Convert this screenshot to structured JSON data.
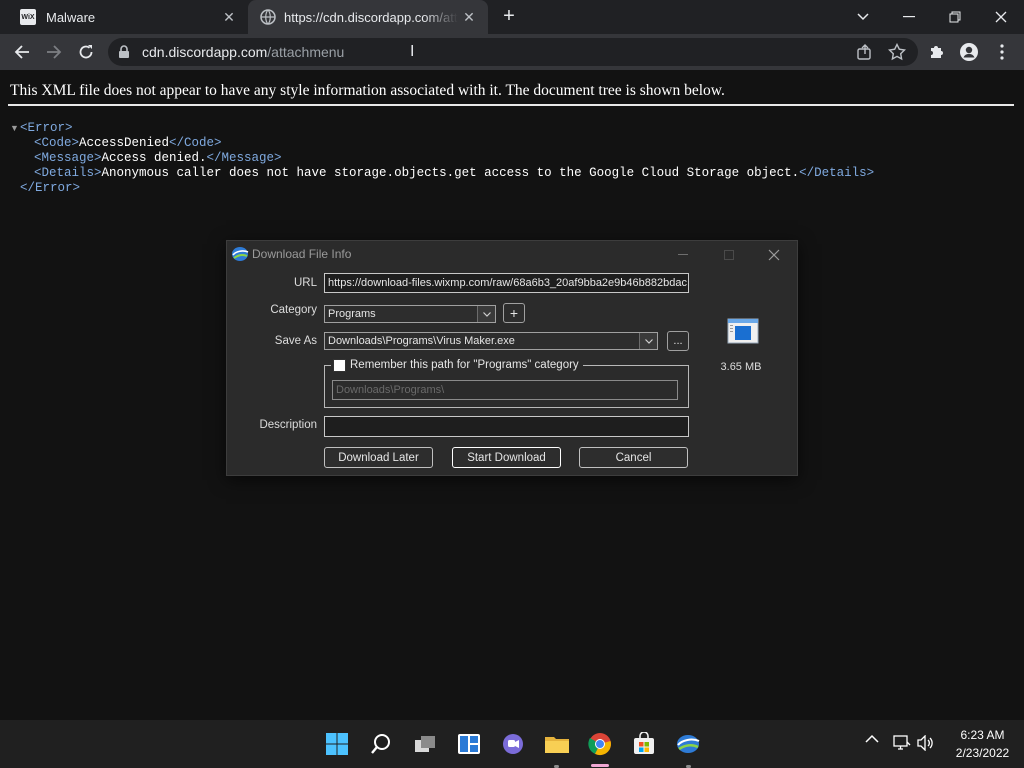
{
  "browser": {
    "tabs": [
      {
        "title": "Malware",
        "favicon": "wix-icon"
      },
      {
        "title": "https://cdn.discordapp.com/attachmenu",
        "favicon": "globe-icon",
        "active": true
      }
    ],
    "address": {
      "host": "cdn.discordapp.com",
      "path": "/attachmenu"
    }
  },
  "xml_viewer": {
    "info": "This XML file does not appear to have any style information associated with it. The document tree is shown below.",
    "error_open": "<Error>",
    "error_close": "</Error>",
    "code_open": "<Code>",
    "code_value": "AccessDenied",
    "code_close": "</Code>",
    "message_open": "<Message>",
    "message_value": "Access denied.",
    "message_close": "</Message>",
    "details_open": "<Details>",
    "details_value": "Anonymous caller does not have storage.objects.get access to the Google Cloud Storage object.",
    "details_close": "</Details>"
  },
  "dialog": {
    "title": "Download File Info",
    "url_label": "URL",
    "url_value": "https://download-files.wixmp.com/raw/68a6b3_20af9bba2e9b46b882bdac",
    "category_label": "Category",
    "category_value": "Programs",
    "add_category_label": "+",
    "save_as_label": "Save As",
    "save_as_value": "Downloads\\Programs\\Virus Maker.exe",
    "browse_label": "...",
    "remember_label": "Remember this path for \"Programs\" category",
    "remember_path": "Downloads\\Programs\\",
    "description_label": "Description",
    "description_value": "",
    "file_size": "3.65 MB",
    "buttons": {
      "later": "Download Later",
      "start": "Start Download",
      "cancel": "Cancel"
    }
  },
  "taskbar": {
    "apps": [
      "windows-start-icon",
      "search-icon",
      "task-view-icon",
      "widgets-icon",
      "teams-chat-icon",
      "file-explorer-icon",
      "chrome-icon",
      "microsoft-store-icon",
      "idm-icon"
    ],
    "time": "6:23 AM",
    "date": "2/23/2022"
  },
  "colors": {
    "xml_tag": "#7fa9df",
    "page_bg": "#121212",
    "dialog_bg": "#2b2b2b"
  }
}
